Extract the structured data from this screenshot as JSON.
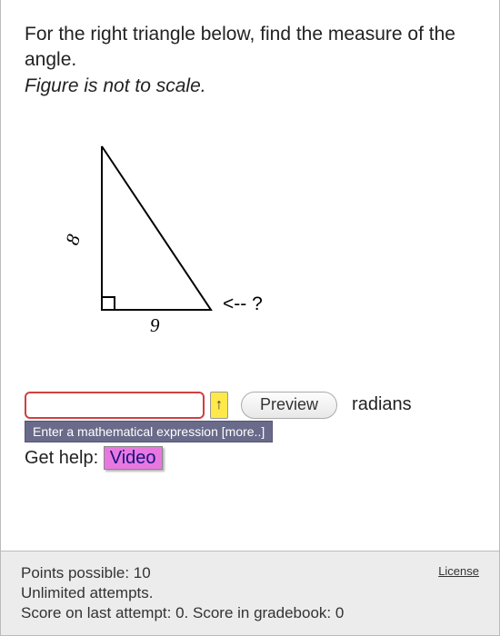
{
  "question": {
    "prompt": "For the right triangle below, find the measure of the angle.",
    "note": "Figure is not to scale.",
    "figure": {
      "side_vertical": "8",
      "side_horizontal": "9",
      "angle_marker": "<-- ?"
    }
  },
  "input": {
    "value": "",
    "arrow": "↑",
    "preview_label": "Preview",
    "unit": "radians",
    "tooltip": "Enter a mathematical expression [more..]"
  },
  "help": {
    "label": "Get help:",
    "video": "Video"
  },
  "footer": {
    "points": "Points possible: 10",
    "attempts": "Unlimited attempts.",
    "score": "Score on last attempt: 0. Score in gradebook: 0",
    "license": "License"
  }
}
